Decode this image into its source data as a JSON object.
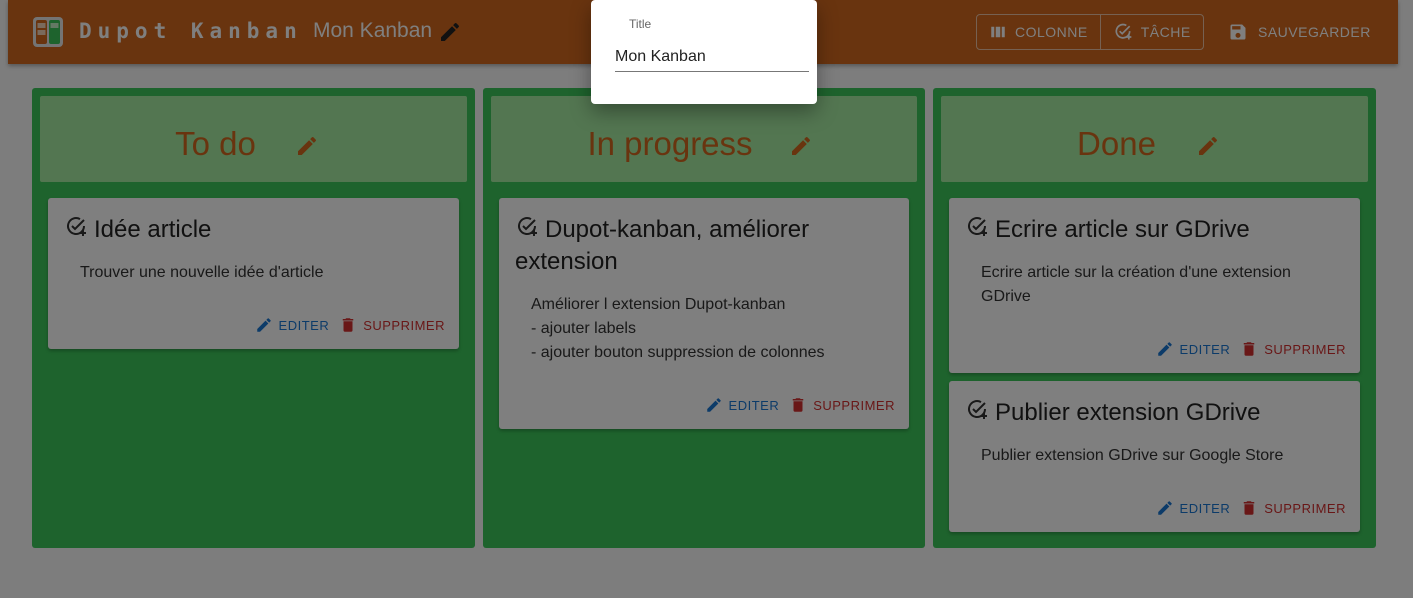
{
  "app": {
    "title": "Dupot Kanban",
    "board_title": "Mon Kanban"
  },
  "toolbar": {
    "column_label": "COLONNE",
    "task_label": "TÂCHE",
    "save_label": "SAUVEGARDER"
  },
  "columns": [
    {
      "title": "To do",
      "cards": [
        {
          "title": "Idée article",
          "description": "Trouver une nouvelle idée d'article"
        }
      ]
    },
    {
      "title": "In progress",
      "cards": [
        {
          "title": "Dupot-kanban, améliorer extension",
          "description": "Améliorer l extension Dupot-kanban\n- ajouter labels\n- ajouter bouton suppression de colonnes"
        }
      ]
    },
    {
      "title": "Done",
      "cards": [
        {
          "title": "Ecrire article sur GDrive",
          "description": "Ecrire article sur la création d'une extension GDrive"
        },
        {
          "title": "Publier extension GDrive",
          "description": "Publier extension GDrive sur Google Store"
        }
      ]
    }
  ],
  "card_actions": {
    "edit_label": "EDITER",
    "delete_label": "SUPPRIMER"
  },
  "dialog": {
    "field_label": "Title",
    "field_value": "Mon Kanban"
  },
  "colors": {
    "appbar": "#d2691e",
    "column": "#3cc65a",
    "column_header": "#a6eda2",
    "column_title": "#d2691e",
    "edit": "#1976d2",
    "delete": "#d32f2f"
  }
}
